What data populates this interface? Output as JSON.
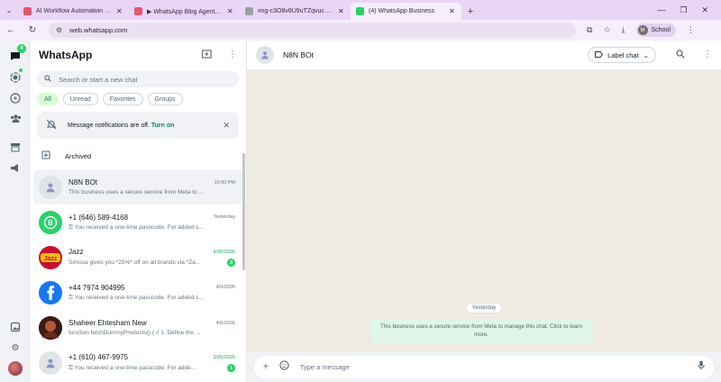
{
  "browser": {
    "tabs": [
      {
        "title": "AI Workflow Automation Platfo",
        "fav_color": "#e9546b",
        "active": false
      },
      {
        "title": "▶ WhatsApp Blog Agent V2 - n",
        "fav_color": "#e9546b",
        "active": false
      },
      {
        "title": "img-c3O8v8U9uTZqvucDPoTa...",
        "fav_color": "#9aa0a6",
        "active": false
      },
      {
        "title": "(4) WhatsApp Business",
        "fav_color": "#25d366",
        "active": true
      }
    ],
    "url": "web.whatsapp.com",
    "profile_initial": "M",
    "profile_label": "School"
  },
  "rail": {
    "chats_badge": "4"
  },
  "sidebar": {
    "title": "WhatsApp",
    "search_placeholder": "Search or start a new chat",
    "filters": [
      "All",
      "Unread",
      "Favorites",
      "Groups"
    ],
    "active_filter": "All",
    "notification": {
      "text": "Message notifications are off.",
      "link": "Turn on"
    },
    "archived_label": "Archived",
    "chats": [
      {
        "name": "N8N BOt",
        "time": "10:00 PM",
        "preview": "This business uses a secure service from Meta to ...",
        "unread": "",
        "avatar_type": "person",
        "avatar_color": "#dfe5e7",
        "selected": true,
        "key_icon": false
      },
      {
        "name": "+1 (646) 589-4168",
        "time": "Yesterday",
        "preview": "You received a one-time passcode. For added s...",
        "unread": "",
        "avatar_type": "whatsapp",
        "avatar_color": "#25d366",
        "selected": false,
        "key_icon": true
      },
      {
        "name": "Jazz",
        "time": "4/30/2026",
        "preview": "Simosa gives you *25%* off on all brands via *Za...",
        "unread": "3",
        "avatar_type": "jazz",
        "avatar_color": "#c8102e",
        "selected": false,
        "key_icon": false
      },
      {
        "name": "+44 7974 904995",
        "time": "4/9/2026",
        "preview": "You received a one-time passcode. For added s...",
        "unread": "",
        "avatar_type": "facebook",
        "avatar_color": "#1877f2",
        "selected": false,
        "key_icon": true
      },
      {
        "name": "Shaheer Ehtesham New",
        "time": "4/6/2026",
        "preview": "function fetchDummyProducts() {   // 1. Define the ...",
        "unread": "",
        "avatar_type": "photo",
        "avatar_color": "#8b2b1e",
        "selected": false,
        "key_icon": false
      },
      {
        "name": "+1 (610) 467-9975",
        "time": "3/25/2026",
        "preview": "You received a one-time passcode. For adde...",
        "unread": "1",
        "avatar_type": "person",
        "avatar_color": "#dfe5e7",
        "selected": false,
        "key_icon": true
      }
    ]
  },
  "conversation": {
    "contact_name": "N8N BOt",
    "label_button": "Label chat",
    "date_separator": "Yesterday",
    "system_message": "This business uses a secure service from Meta to manage this chat. Click to learn more.",
    "composer_placeholder": "Type a message"
  }
}
